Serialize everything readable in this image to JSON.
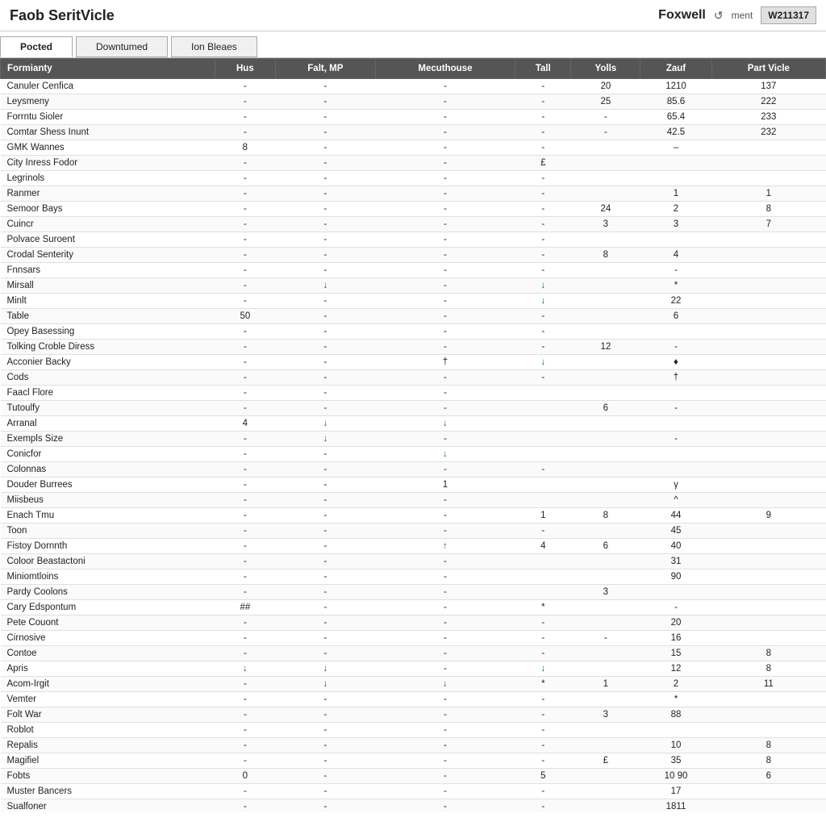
{
  "header": {
    "title": "Faob SeritVicle",
    "brand": "Foxwell",
    "ment_label": "ment",
    "badge": "W211317"
  },
  "tabs": [
    {
      "label": "Pocted",
      "active": true
    },
    {
      "label": "Downtumed",
      "active": false
    },
    {
      "label": "Ion Bleaes",
      "active": false
    }
  ],
  "table": {
    "columns": [
      "Formianty",
      "Hus",
      "Falt, MP",
      "Mecuthouse",
      "Tall",
      "Yolls",
      "Zauf",
      "Part Vicle"
    ],
    "rows": [
      [
        "Canuler Cenfica",
        "-",
        "-",
        "-",
        "-",
        "20",
        "1210",
        "137"
      ],
      [
        "Leysmeny",
        "-",
        "-",
        "-",
        "-",
        "25",
        "85.6",
        "222"
      ],
      [
        "Forrntu Sioler",
        "-",
        "-",
        "-",
        "-",
        "-",
        "65.4",
        "233"
      ],
      [
        "Comtar Shess Inunt",
        "-",
        "-",
        "-",
        "-",
        "-",
        "42.5",
        "232"
      ],
      [
        "GMK Wannes",
        "8",
        "-",
        "-",
        "-",
        "",
        "–",
        ""
      ],
      [
        "City Inress Fodor",
        "-",
        "-",
        "-",
        "£",
        "",
        "",
        ""
      ],
      [
        "Legrinols",
        "-",
        "-",
        "-",
        "-",
        "",
        "",
        ""
      ],
      [
        "Ranmer",
        "-",
        "-",
        "-",
        "-",
        "",
        "1",
        "1"
      ],
      [
        "Semoor Bays",
        "-",
        "-",
        "-",
        "-",
        "24",
        "2",
        "8"
      ],
      [
        "Cuincr",
        "-",
        "-",
        "-",
        "-",
        "3",
        "3",
        "7"
      ],
      [
        "Polvace Suroent",
        "-",
        "-",
        "-",
        "-",
        "",
        "",
        ""
      ],
      [
        "Crodal Senterity",
        "-",
        "-",
        "-",
        "-",
        "8",
        "4",
        ""
      ],
      [
        "Fnnsars",
        "-",
        "-",
        "-",
        "-",
        "",
        "-",
        ""
      ],
      [
        "Mirsall",
        "-",
        "↓",
        "-",
        "↓",
        "",
        "*",
        ""
      ],
      [
        "Minlt",
        "-",
        "-",
        "-",
        "↓",
        "",
        "22",
        ""
      ],
      [
        "Table",
        "50",
        "-",
        "-",
        "-",
        "",
        "6",
        ""
      ],
      [
        "Opey Basessing",
        "-",
        "-",
        "-",
        "-",
        "",
        "",
        ""
      ],
      [
        "Tolking Croble Diress",
        "-",
        "-",
        "-",
        "-",
        "12",
        "-",
        ""
      ],
      [
        "Acconier Backy",
        "-",
        "-",
        "†",
        "↓",
        "",
        "♦",
        ""
      ],
      [
        "Cods",
        "-",
        "-",
        "-",
        "-",
        "",
        "†",
        ""
      ],
      [
        "Faacl Flore",
        "-",
        "-",
        "-",
        "",
        "",
        "",
        ""
      ],
      [
        "Tutoulfy",
        "-",
        "-",
        "-",
        "",
        "6",
        "-",
        ""
      ],
      [
        "Arranal",
        "4",
        "↓",
        "↓",
        "",
        "",
        "",
        ""
      ],
      [
        "Exempls Size",
        "-",
        "↓",
        "-",
        "",
        "",
        "-",
        ""
      ],
      [
        "Conicfor",
        "-",
        "-",
        "↓",
        "",
        "",
        "",
        ""
      ],
      [
        "Colonnas",
        "-",
        "-",
        "-",
        "-",
        "",
        "",
        ""
      ],
      [
        "Douder Burrees",
        "-",
        "-",
        "1",
        "",
        "",
        "γ",
        ""
      ],
      [
        "Miisbeus",
        "-",
        "-",
        "-",
        "",
        "",
        "^",
        ""
      ],
      [
        "Enach Tmu",
        "-",
        "-",
        "-",
        "1",
        "8",
        "44",
        "9"
      ],
      [
        "Toon",
        "-",
        "-",
        "-",
        "-",
        "",
        "45",
        ""
      ],
      [
        "Fistoy Dornnth",
        "-",
        "-",
        "↑",
        "4",
        "6",
        "40",
        ""
      ],
      [
        "Coloor Beastactoni",
        "-",
        "-",
        "-",
        "",
        "",
        "31",
        ""
      ],
      [
        "Miniomtloins",
        "-",
        "-",
        "-",
        "",
        "",
        "90",
        ""
      ],
      [
        "Pardy Coolons",
        "-",
        "-",
        "-",
        "",
        "3",
        "",
        ""
      ],
      [
        "Cary Edspontum",
        "##",
        "-",
        "-",
        "*",
        "",
        "-",
        ""
      ],
      [
        "Pete Couont",
        "-",
        "-",
        "-",
        "-",
        "",
        "20",
        ""
      ],
      [
        "Cirnosive",
        "-",
        "-",
        "-",
        "-",
        "-",
        "16",
        ""
      ],
      [
        "Contoe",
        "-",
        "-",
        "-",
        "-",
        "",
        "15",
        "8"
      ],
      [
        "Apris",
        "↓",
        "↓",
        "-",
        "↓",
        "",
        "12",
        "8"
      ],
      [
        "Acom-Irgit",
        "-",
        "↓",
        "↓",
        "*",
        "1",
        "2",
        "11"
      ],
      [
        "Vemter",
        "-",
        "-",
        "-",
        "-",
        "",
        "*",
        ""
      ],
      [
        "Folt War",
        "-",
        "-",
        "-",
        "-",
        "3",
        "88",
        ""
      ],
      [
        "Roblot",
        "-",
        "-",
        "-",
        "-",
        "",
        "",
        ""
      ],
      [
        "Repalis",
        "-",
        "-",
        "-",
        "-",
        "",
        "10",
        "8"
      ],
      [
        "Magifiel",
        "-",
        "-",
        "-",
        "-",
        "£",
        "35",
        "8"
      ],
      [
        "Fobts",
        "0",
        "-",
        "-",
        "5",
        "",
        "10 90",
        "6"
      ],
      [
        "Muster Bancers",
        "-",
        "-",
        "-",
        "-",
        "",
        "17",
        ""
      ],
      [
        "Sualfoner",
        "-",
        "-",
        "-",
        "-",
        "",
        "1811",
        ""
      ]
    ]
  },
  "colors": {
    "header_bg": "#555555",
    "header_text": "#ffffff",
    "green": "#008800"
  }
}
